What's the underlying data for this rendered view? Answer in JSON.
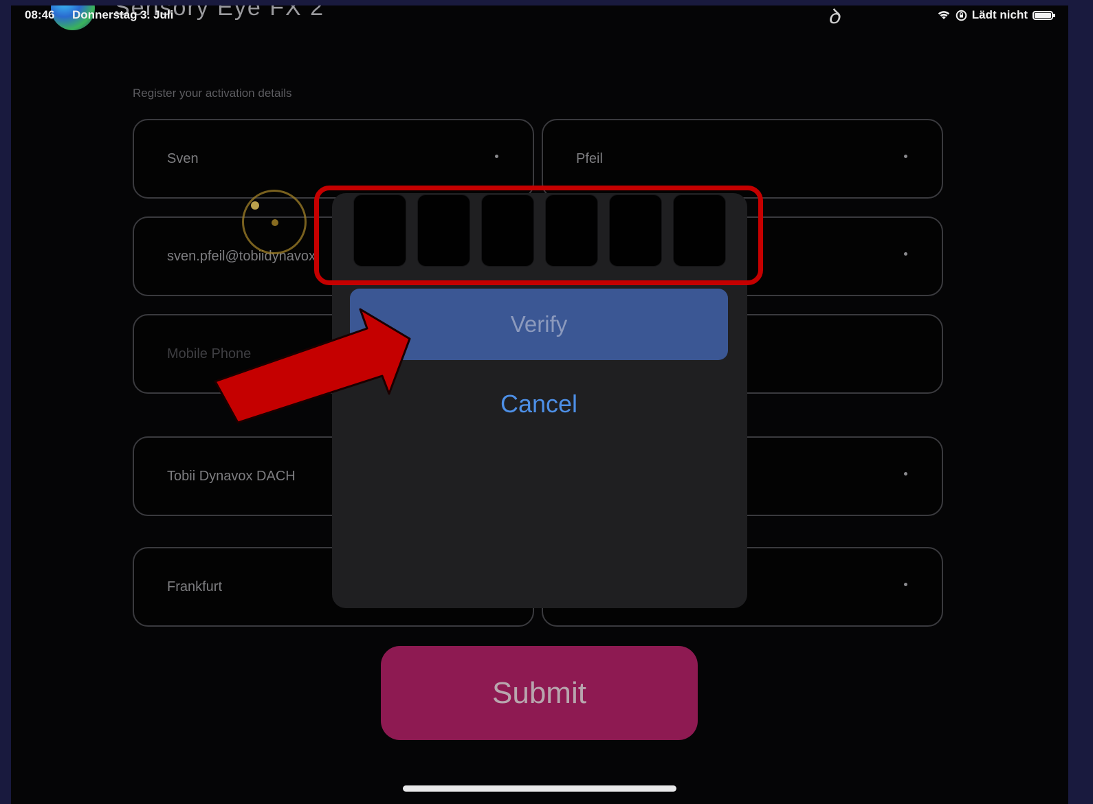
{
  "status_bar": {
    "time": "08:46",
    "date": "Donnerstag 3. Juli",
    "app_title": "Sensory Eye FX 2",
    "charging_status": "Lädt nicht",
    "icons": [
      "wifi-icon",
      "orientation-lock-icon",
      "battery-icon"
    ]
  },
  "form": {
    "section_label": "Register your activation details",
    "fields": {
      "first_name": "Sven",
      "last_name": "Pfeil",
      "email": "sven.pfeil@tobiidynavox.",
      "mobile_phone_placeholder": "Mobile Phone",
      "organization": "Tobii Dynavox DACH",
      "city": "Frankfurt"
    },
    "submit_label": "Submit"
  },
  "verify_dialog": {
    "code_cells": [
      "",
      "",
      "",
      "",
      "",
      ""
    ],
    "verify_label": "Verify",
    "cancel_label": "Cancel"
  },
  "annotations": {
    "highlight_color": "#c50000",
    "arrow_color": "#c50000"
  },
  "colors": {
    "verify_button": "#3b5794",
    "cancel_text": "#4d8fe6",
    "submit_button": "#8e1a52",
    "background": "#050506"
  }
}
